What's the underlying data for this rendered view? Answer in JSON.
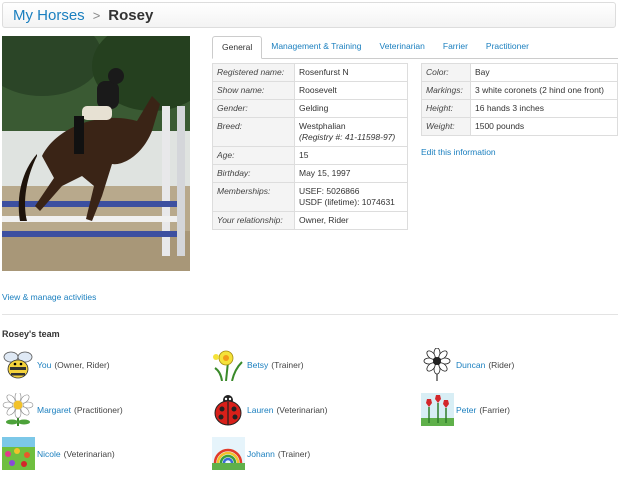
{
  "breadcrumb": {
    "parent": "My Horses",
    "separator": ">",
    "current": "Rosey"
  },
  "tabs": [
    "General",
    "Management & Training",
    "Veterinarian",
    "Farrier",
    "Practitioner"
  ],
  "details_left": [
    {
      "label": "Registered name:",
      "value": "Rosenfurst N"
    },
    {
      "label": "Show name:",
      "value": "Roosevelt"
    },
    {
      "label": "Gender:",
      "value": "Gelding"
    },
    {
      "label": "Breed:",
      "value": "Westphalian",
      "extra": "(Registry #: 41-11598-97)"
    },
    {
      "label": "Age:",
      "value": "15"
    },
    {
      "label": "Birthday:",
      "value": "May 15, 1997"
    },
    {
      "label": "Memberships:",
      "value": "USEF: 5026866",
      "extra": "USDF (lifetime): 1074631"
    },
    {
      "label": "Your relationship:",
      "value": "Owner, Rider"
    }
  ],
  "details_right": [
    {
      "label": "Color:",
      "value": "Bay"
    },
    {
      "label": "Markings:",
      "value": "3 white coronets (2 hind one front)"
    },
    {
      "label": "Height:",
      "value": "16 hands 3 inches"
    },
    {
      "label": "Weight:",
      "value": "1500 pounds"
    }
  ],
  "edit_link": "Edit this information",
  "activities_link": "View & manage activities",
  "team_title": "Rosey's team",
  "team": [
    {
      "name": "You",
      "role": "(Owner, Rider)",
      "icon": "bee-icon"
    },
    {
      "name": "Betsy",
      "role": "(Trainer)",
      "icon": "daffodil-icon"
    },
    {
      "name": "Duncan",
      "role": "(Rider)",
      "icon": "flower-sketch-icon"
    },
    {
      "name": "Margaret",
      "role": "(Practitioner)",
      "icon": "daisy-icon"
    },
    {
      "name": "Lauren",
      "role": "(Veterinarian)",
      "icon": "ladybug-icon"
    },
    {
      "name": "Peter",
      "role": "(Farrier)",
      "icon": "tulips-icon"
    },
    {
      "name": "Nicole",
      "role": "(Veterinarian)",
      "icon": "garden-icon"
    },
    {
      "name": "Johann",
      "role": "(Trainer)",
      "icon": "rainbow-icon"
    }
  ]
}
